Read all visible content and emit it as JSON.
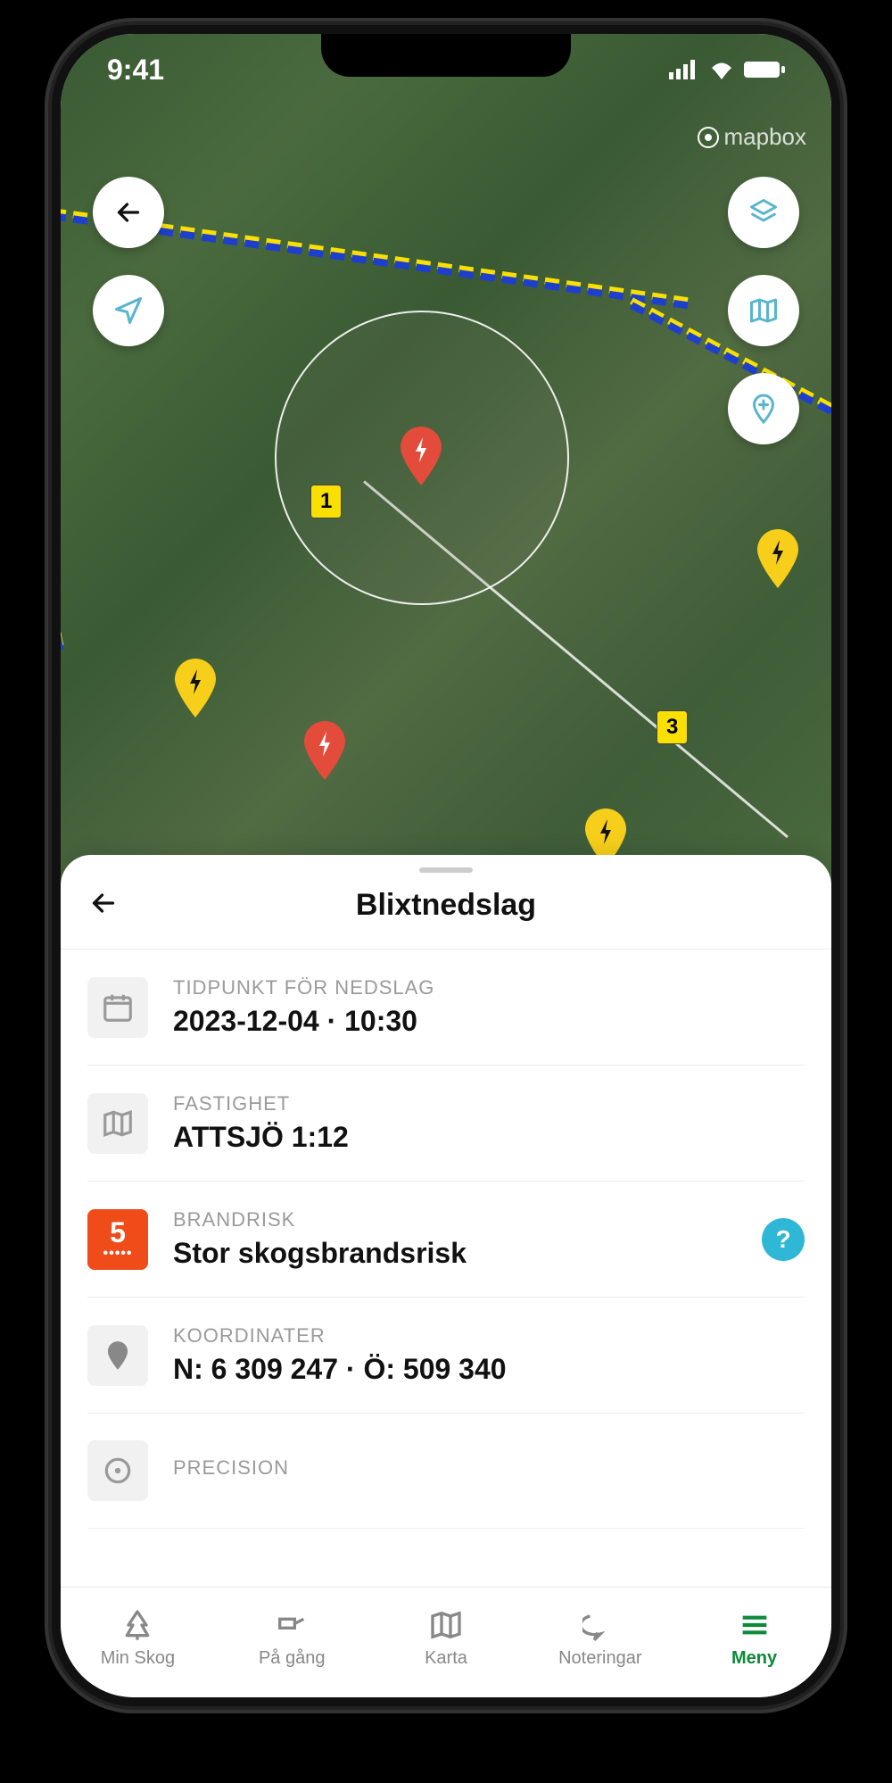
{
  "status_bar": {
    "time": "9:41"
  },
  "attribution": {
    "label": "mapbox"
  },
  "map": {
    "parcel_labels": {
      "one": "1",
      "three": "3"
    }
  },
  "sheet": {
    "title": "Blixtnedslag",
    "rows": {
      "time": {
        "label": "TIDPUNKT FÖR NEDSLAG",
        "value": "2023-12-04 · 10:30"
      },
      "property": {
        "label": "FASTIGHET",
        "value": "ATTSJÖ 1:12"
      },
      "risk": {
        "label": "BRANDRISK",
        "value": "Stor skogsbrandsrisk",
        "level": "5"
      },
      "coords": {
        "label": "KOORDINATER",
        "value": "N: 6 309 247 · Ö: 509 340"
      },
      "precision": {
        "label": "PRECISION"
      }
    },
    "help": "?"
  },
  "tabs": {
    "min_skog": "Min Skog",
    "pa_gang": "På gång",
    "karta": "Karta",
    "noteringar": "Noteringar",
    "meny": "Meny"
  }
}
